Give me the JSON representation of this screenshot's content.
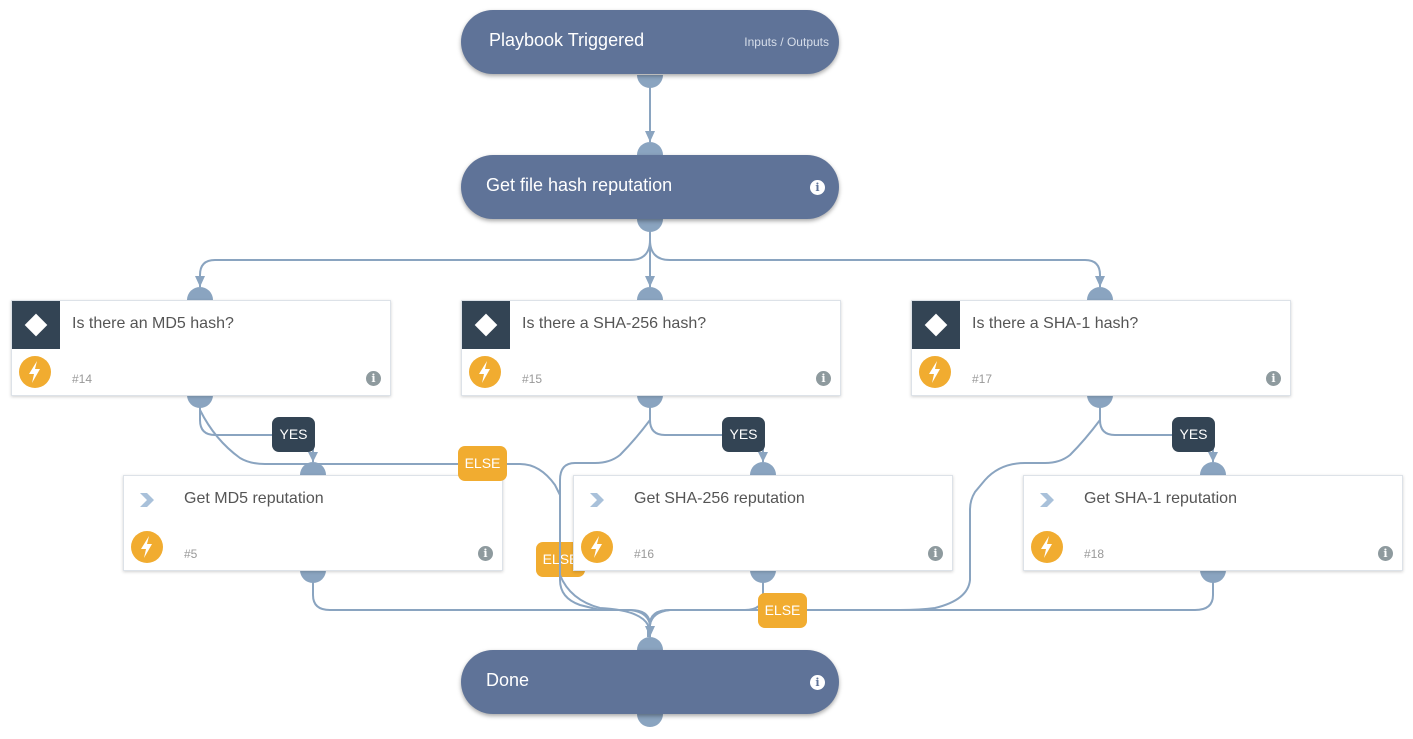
{
  "colors": {
    "terminal_node": "#5f7398",
    "connector": "#8aa4c0",
    "condition_box": "#334454",
    "yes_label": "#334454",
    "else_label": "#f1ac30",
    "automation_badge": "#f1ac30"
  },
  "nodes": {
    "trigger": {
      "title": "Playbook Triggered",
      "link": "Inputs / Outputs"
    },
    "hash_rep": {
      "title": "Get file hash reputation",
      "icon": "info-icon"
    },
    "cond_md5": {
      "title": "Is there an MD5 hash?",
      "id": "#14",
      "kind": "condition",
      "icon": "diamond-icon"
    },
    "cond_sha256": {
      "title": "Is there a SHA-256 hash?",
      "id": "#15",
      "kind": "condition",
      "icon": "diamond-icon"
    },
    "cond_sha1": {
      "title": "Is there a SHA-1 hash?",
      "id": "#17",
      "kind": "condition",
      "icon": "diamond-icon"
    },
    "task_md5": {
      "title": "Get MD5 reputation",
      "id": "#5",
      "kind": "playbook",
      "icon": "chevron-icon"
    },
    "task_sha256": {
      "title": "Get SHA-256 reputation",
      "id": "#16",
      "kind": "playbook",
      "icon": "chevron-icon"
    },
    "task_sha1": {
      "title": "Get SHA-1 reputation",
      "id": "#18",
      "kind": "playbook",
      "icon": "chevron-icon"
    },
    "done": {
      "title": "Done",
      "icon": "info-icon"
    }
  },
  "branch_labels": {
    "yes": "YES",
    "else": "ELSE"
  },
  "info_glyph": "i"
}
